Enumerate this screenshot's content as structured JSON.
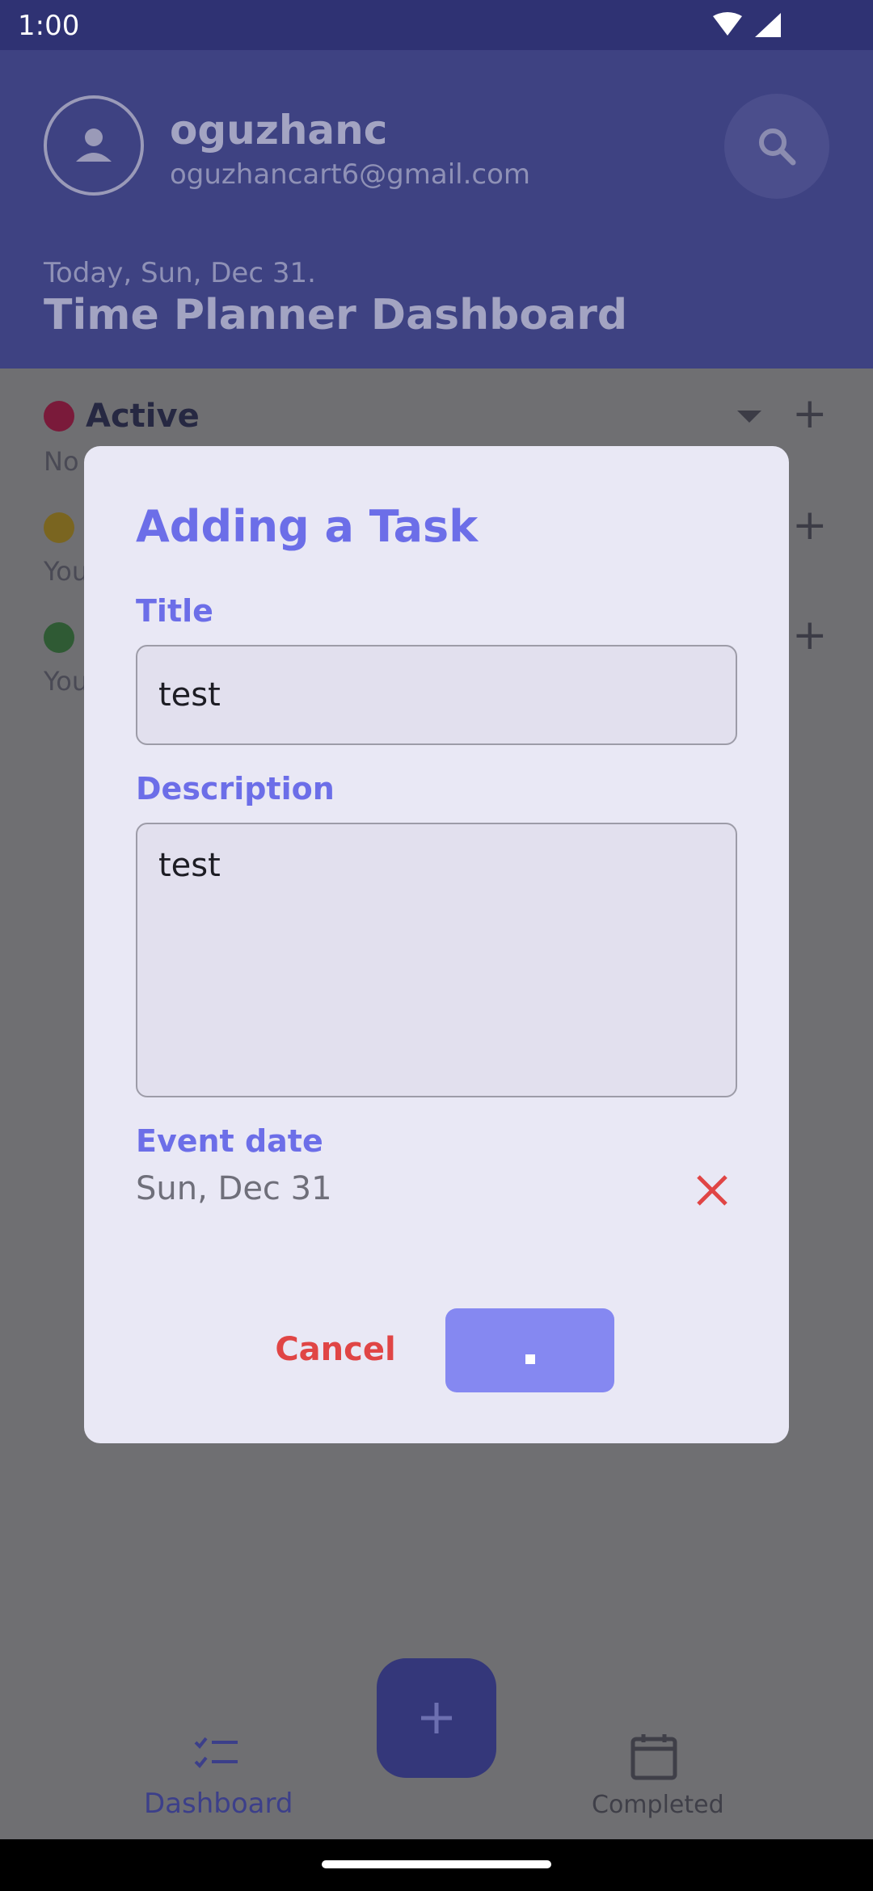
{
  "status_bar": {
    "time": "1:00"
  },
  "header": {
    "user_name": "oguzhanc",
    "user_email": "oguzhancart6@gmail.com",
    "today": "Today, Sun, Dec 31.",
    "title": "Time Planner Dashboard"
  },
  "background": {
    "active_label": "Active",
    "active_snippet": "No",
    "pending_snippet": "You",
    "done_snippet": "You"
  },
  "dialog": {
    "title": "Adding a Task",
    "title_label": "Title",
    "title_value": "test",
    "description_label": "Description",
    "description_value": "test",
    "event_date_label": "Event date",
    "event_date_value": "Sun, Dec 31",
    "cancel_label": "Cancel"
  },
  "bottom_nav": {
    "dashboard_label": "Dashboard",
    "completed_label": "Completed"
  },
  "colors": {
    "accent": "#6c6ee8",
    "danger": "#e04545",
    "save_button": "#8588f1",
    "dialog_bg": "#e9e8f5"
  }
}
